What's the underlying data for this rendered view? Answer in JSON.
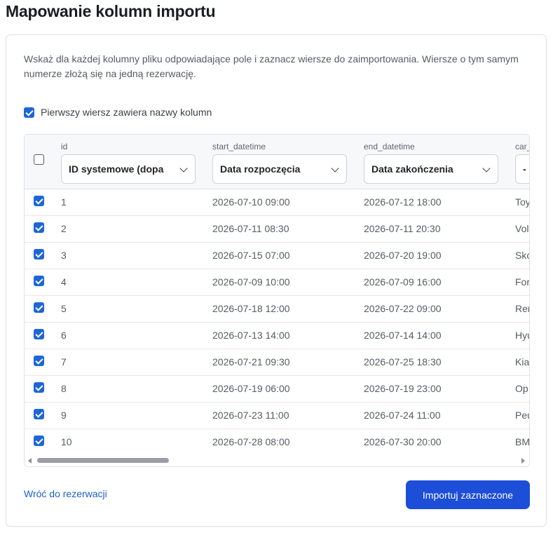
{
  "page": {
    "title": "Mapowanie kolumn importu"
  },
  "intro": {
    "text": "Wskaż dla każdej kolumny pliku odpowiadające pole i zaznacz wiersze do zaimportowania. Wiersze o tym samym numerze złożą się na jedną rezerwację."
  },
  "header_toggle": {
    "label": "Pierwszy wiersz zawiera nazwy kolumn",
    "checked": true
  },
  "table": {
    "select_all_checked": false,
    "columns": [
      {
        "name": "id",
        "mapping": "ID systemowe (dopa"
      },
      {
        "name": "start_datetime",
        "mapping": "Data rozpoczęcia"
      },
      {
        "name": "end_datetime",
        "mapping": "Data zakończenia"
      },
      {
        "name": "car_",
        "mapping": "-"
      }
    ],
    "rows": [
      {
        "checked": true,
        "id": "1",
        "start": "2026-07-10 09:00",
        "end": "2026-07-12 18:00",
        "car": "Toy"
      },
      {
        "checked": true,
        "id": "2",
        "start": "2026-07-11 08:30",
        "end": "2026-07-11 20:30",
        "car": "Vol"
      },
      {
        "checked": true,
        "id": "3",
        "start": "2026-07-15 07:00",
        "end": "2026-07-20 19:00",
        "car": "Skc"
      },
      {
        "checked": true,
        "id": "4",
        "start": "2026-07-09 10:00",
        "end": "2026-07-09 16:00",
        "car": "For"
      },
      {
        "checked": true,
        "id": "5",
        "start": "2026-07-18 12:00",
        "end": "2026-07-22 09:00",
        "car": "Rer"
      },
      {
        "checked": true,
        "id": "6",
        "start": "2026-07-13 14:00",
        "end": "2026-07-14 14:00",
        "car": "Hyu"
      },
      {
        "checked": true,
        "id": "7",
        "start": "2026-07-21 09:30",
        "end": "2026-07-25 18:30",
        "car": "Kia"
      },
      {
        "checked": true,
        "id": "8",
        "start": "2026-07-19 06:00",
        "end": "2026-07-19 23:00",
        "car": "Op"
      },
      {
        "checked": true,
        "id": "9",
        "start": "2026-07-23 11:00",
        "end": "2026-07-24 11:00",
        "car": "Peu"
      },
      {
        "checked": true,
        "id": "10",
        "start": "2026-07-28 08:00",
        "end": "2026-07-30 20:00",
        "car": "BM"
      }
    ]
  },
  "actions": {
    "back_label": "Wróć do rezerwacji",
    "import_label": "Importuj zaznaczone"
  },
  "colors": {
    "accent": "#1d4ed8",
    "link": "#1e5fc9",
    "checkbox": "#1e66d8"
  }
}
